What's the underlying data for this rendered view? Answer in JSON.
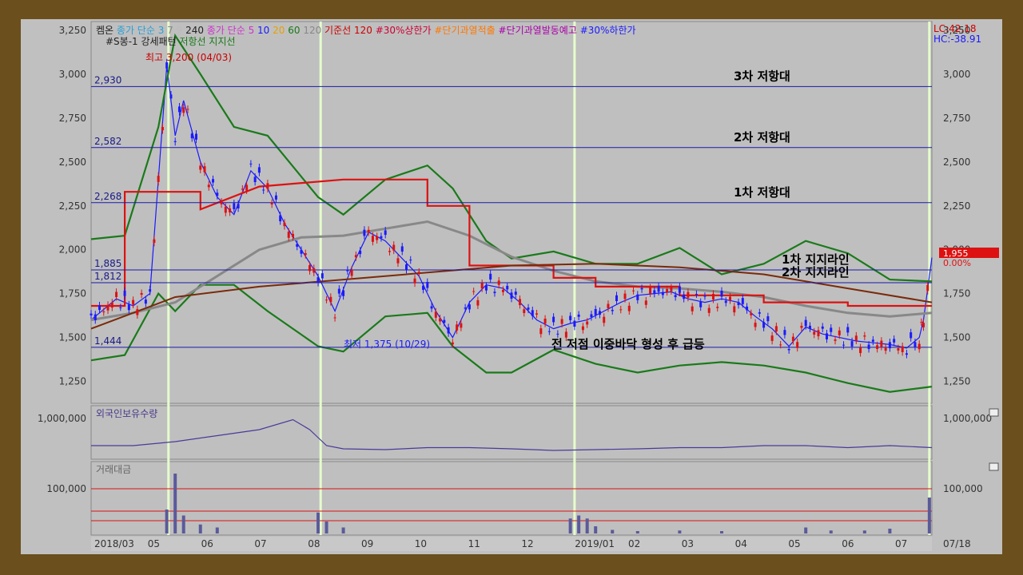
{
  "chart_data": {
    "type": "candlestick",
    "header": {
      "legend_line1": [
        {
          "text": "켐온",
          "color": "#222222"
        },
        {
          "text": "종가 단순 3",
          "color": "#2a9fd6"
        },
        {
          "text": "7",
          "color": "#888888"
        },
        {
          "text": "9",
          "color": "#bbbbbb"
        },
        {
          "text": "240",
          "color": "#222222"
        },
        {
          "text": "종가 단순 5",
          "color": "#cc33cc"
        },
        {
          "text": "10",
          "color": "#1a1aff"
        },
        {
          "text": "20",
          "color": "#e8a000"
        },
        {
          "text": "60",
          "color": "#1a7a1a"
        },
        {
          "text": "120",
          "color": "#888888"
        },
        {
          "text": "기준선 120",
          "color": "#cc0000"
        },
        {
          "text": "#30%상한가",
          "color": "#cc0033"
        },
        {
          "text": "#단기과열적출",
          "color": "#ff7700"
        },
        {
          "text": "#단기과열발동예고",
          "color": "#aa00aa"
        },
        {
          "text": "#30%하한가",
          "color": "#1a1aff"
        }
      ],
      "legend_line2": [
        {
          "text": "#S봉-1 강세패턴",
          "color": "#222222"
        },
        {
          "text": "저항선",
          "color": "#1a7a1a"
        },
        {
          "text": "지지선",
          "color": "#1a7a1a"
        }
      ],
      "lc": "LC:42.18",
      "hc": "HC:-38.91"
    },
    "price_panel": {
      "ylim": [
        1125,
        3300
      ],
      "yticks": [
        1250,
        1500,
        1750,
        2000,
        2250,
        2500,
        2750,
        3000,
        3250
      ],
      "ytick_labels": [
        "1,250",
        "1,500",
        "1,750",
        "2,000",
        "2,250",
        "2,500",
        "2,750",
        "3,000",
        "3,250"
      ],
      "h_lines": [
        {
          "value": 2930,
          "label": "2,930",
          "annotation": "3차 저항대"
        },
        {
          "value": 2582,
          "label": "2,582",
          "annotation": "2차 저항대"
        },
        {
          "value": 2268,
          "label": "2,268",
          "annotation": "1차 저항대"
        },
        {
          "value": 1885,
          "label": "1,885",
          "annotation": "1차 지지라인"
        },
        {
          "value": 1812,
          "label": "1,812",
          "annotation": "2차 지지라인"
        },
        {
          "value": 1444,
          "label": "1,444",
          "annotation": ""
        }
      ],
      "high_marker": {
        "label": "최고 3,200 (04/03)",
        "value": 3200
      },
      "low_marker": {
        "label": "최저 1,375 (10/29)",
        "value": 1375
      },
      "pattern_note": "전 저점 이중바닥 형성 후 급등",
      "last_price": "1,955",
      "last_change": "0.00%",
      "series": [
        {
          "name": "close",
          "x": [
            0,
            0.03,
            0.05,
            0.07,
            0.09,
            0.1,
            0.11,
            0.13,
            0.15,
            0.17,
            0.19,
            0.21,
            0.23,
            0.25,
            0.27,
            0.29,
            0.31,
            0.33,
            0.35,
            0.37,
            0.39,
            0.41,
            0.43,
            0.45,
            0.47,
            0.49,
            0.51,
            0.53,
            0.55,
            0.57,
            0.59,
            0.61,
            0.63,
            0.65,
            0.67,
            0.69,
            0.71,
            0.73,
            0.75,
            0.77,
            0.79,
            0.81,
            0.83,
            0.85,
            0.87,
            0.89,
            0.91,
            0.93,
            0.95,
            0.97,
            0.985,
            0.99,
            1.0
          ],
          "values": [
            1600,
            1720,
            1680,
            1750,
            3050,
            2650,
            2850,
            2500,
            2300,
            2200,
            2450,
            2350,
            2150,
            2000,
            1850,
            1650,
            1900,
            2100,
            2050,
            1950,
            1850,
            1650,
            1500,
            1700,
            1800,
            1780,
            1700,
            1600,
            1550,
            1580,
            1600,
            1650,
            1700,
            1740,
            1750,
            1760,
            1720,
            1700,
            1720,
            1700,
            1620,
            1550,
            1450,
            1560,
            1520,
            1500,
            1480,
            1470,
            1460,
            1440,
            1500,
            1600,
            1955
          ]
        },
        {
          "name": "bollinger_upper",
          "x": [
            0,
            0.04,
            0.08,
            0.1,
            0.13,
            0.17,
            0.21,
            0.27,
            0.3,
            0.35,
            0.4,
            0.43,
            0.47,
            0.5,
            0.55,
            0.6,
            0.65,
            0.7,
            0.75,
            0.8,
            0.85,
            0.9,
            0.95,
            1.0
          ],
          "values": [
            2060,
            2080,
            2700,
            3220,
            3000,
            2700,
            2650,
            2300,
            2200,
            2400,
            2480,
            2350,
            2050,
            1950,
            1990,
            1920,
            1920,
            2010,
            1860,
            1920,
            2050,
            1980,
            1830,
            1820
          ]
        },
        {
          "name": "bollinger_lower",
          "x": [
            0,
            0.04,
            0.08,
            0.1,
            0.13,
            0.17,
            0.21,
            0.27,
            0.3,
            0.35,
            0.4,
            0.43,
            0.47,
            0.5,
            0.55,
            0.6,
            0.65,
            0.7,
            0.75,
            0.8,
            0.85,
            0.9,
            0.95,
            1.0
          ],
          "values": [
            1370,
            1400,
            1750,
            1650,
            1800,
            1800,
            1650,
            1450,
            1420,
            1620,
            1640,
            1450,
            1300,
            1300,
            1430,
            1350,
            1300,
            1340,
            1360,
            1340,
            1300,
            1240,
            1190,
            1220
          ]
        },
        {
          "name": "ma120",
          "x": [
            0,
            0.05,
            0.1,
            0.15,
            0.2,
            0.25,
            0.3,
            0.35,
            0.4,
            0.45,
            0.5,
            0.55,
            0.6,
            0.65,
            0.7,
            0.75,
            0.8,
            0.85,
            0.9,
            0.95,
            1.0
          ],
          "values": [
            1600,
            1640,
            1700,
            1850,
            2000,
            2070,
            2080,
            2120,
            2160,
            2080,
            1960,
            1880,
            1820,
            1790,
            1780,
            1760,
            1730,
            1680,
            1640,
            1620,
            1640
          ]
        },
        {
          "name": "base_line_120",
          "x": [
            0,
            0.04,
            0.04,
            0.13,
            0.13,
            0.2,
            0.3,
            0.4,
            0.4,
            0.45,
            0.45,
            0.55,
            0.55,
            0.6,
            0.6,
            0.7,
            0.7,
            0.8,
            0.8,
            0.9,
            0.9,
            1.0
          ],
          "values": [
            1680,
            1680,
            2330,
            2330,
            2230,
            2360,
            2400,
            2400,
            2250,
            2250,
            1910,
            1910,
            1840,
            1840,
            1790,
            1790,
            1740,
            1740,
            1700,
            1700,
            1680,
            1680
          ]
        },
        {
          "name": "ma240",
          "x": [
            0,
            0.1,
            0.2,
            0.3,
            0.4,
            0.5,
            0.6,
            0.7,
            0.8,
            0.9,
            1.0
          ],
          "values": [
            1550,
            1730,
            1790,
            1830,
            1870,
            1910,
            1920,
            1900,
            1860,
            1780,
            1700
          ]
        }
      ],
      "vertical_event_x": [
        0.092,
        0.273,
        0.575,
        0.997
      ]
    },
    "foreign_panel": {
      "title": "외국인보유수량",
      "ytick_label": "1,000,000",
      "x": [
        0,
        0.05,
        0.1,
        0.15,
        0.2,
        0.24,
        0.26,
        0.28,
        0.3,
        0.35,
        0.4,
        0.45,
        0.5,
        0.55,
        0.6,
        0.65,
        0.7,
        0.75,
        0.8,
        0.85,
        0.9,
        0.95,
        1.0
      ],
      "values": [
        0.3,
        0.3,
        0.4,
        0.55,
        0.7,
        0.95,
        0.7,
        0.3,
        0.22,
        0.2,
        0.25,
        0.25,
        0.22,
        0.18,
        0.2,
        0.22,
        0.25,
        0.25,
        0.3,
        0.3,
        0.25,
        0.3,
        0.25
      ]
    },
    "volume_panel": {
      "title": "거래대금",
      "ytick_label": "100,000",
      "x": [
        0.09,
        0.1,
        0.11,
        0.13,
        0.15,
        0.27,
        0.28,
        0.3,
        0.57,
        0.58,
        0.59,
        0.6,
        0.62,
        0.65,
        0.7,
        0.75,
        0.85,
        0.88,
        0.92,
        0.95,
        0.997
      ],
      "values": [
        0.4,
        1.0,
        0.3,
        0.15,
        0.1,
        0.35,
        0.2,
        0.1,
        0.25,
        0.3,
        0.25,
        0.12,
        0.06,
        0.04,
        0.05,
        0.04,
        0.1,
        0.05,
        0.05,
        0.08,
        0.6
      ]
    },
    "x_axis": {
      "labels": [
        "2018/03",
        "05",
        "06",
        "07",
        "08",
        "09",
        "10",
        "11",
        "12",
        "2019/01",
        "02",
        "03",
        "04",
        "05",
        "06",
        "07"
      ],
      "right_label": "07/18"
    }
  }
}
